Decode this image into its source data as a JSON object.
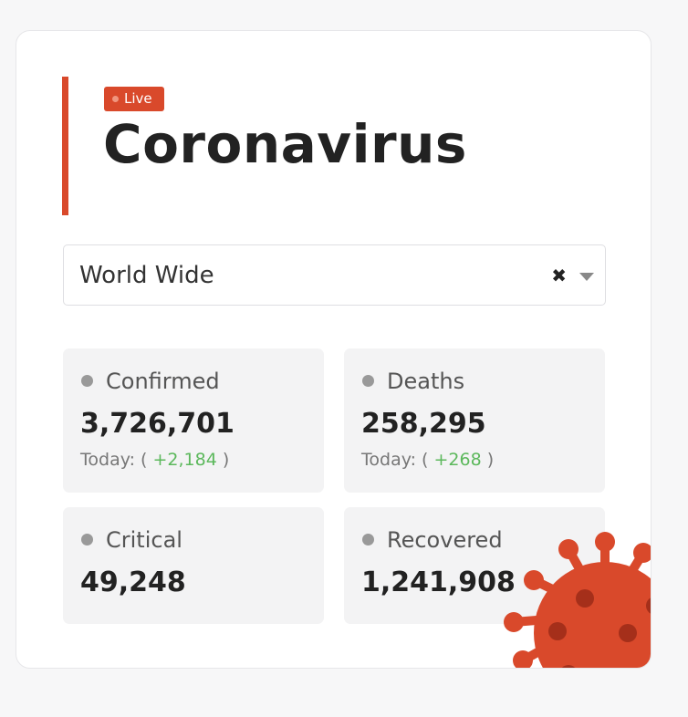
{
  "header": {
    "badge_label": "Live",
    "title": "Coronavirus"
  },
  "region_select": {
    "value": "World Wide",
    "clear_glyph": "✖"
  },
  "stats": [
    {
      "label": "Confirmed",
      "value": "3,726,701",
      "today_prefix": "Today: (",
      "today_delta": "+2,184",
      "today_suffix": ")"
    },
    {
      "label": "Deaths",
      "value": "258,295",
      "today_prefix": "Today: (",
      "today_delta": "+268",
      "today_suffix": ")"
    },
    {
      "label": "Critical",
      "value": "49,248"
    },
    {
      "label": "Recovered",
      "value": "1,241,908"
    }
  ],
  "colors": {
    "accent": "#d9492b",
    "delta_positive": "#5cb85c",
    "card_background": "#f3f3f4"
  },
  "icons": {
    "virus": "coronavirus-illustration"
  }
}
